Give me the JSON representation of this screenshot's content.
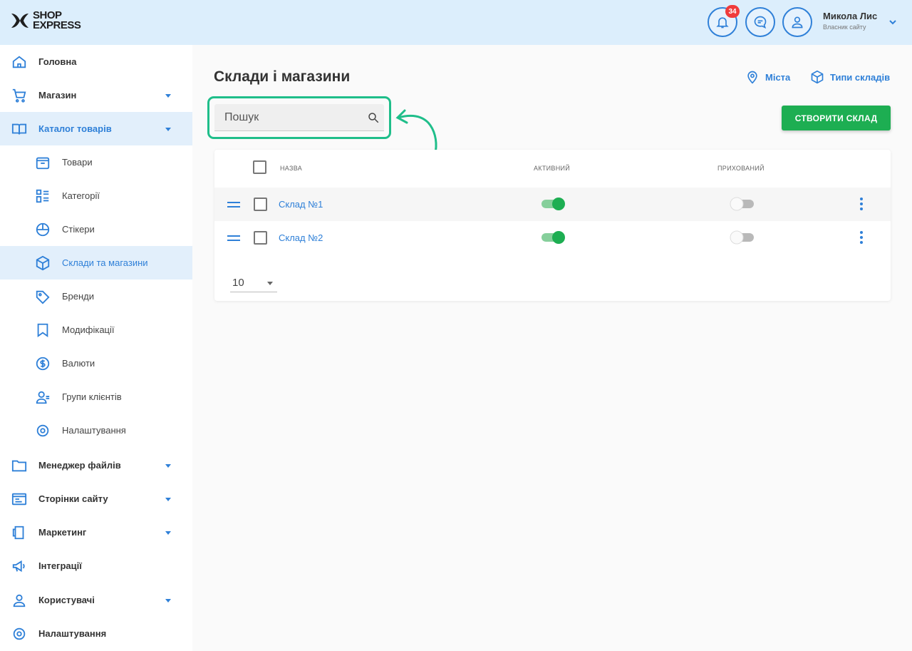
{
  "header": {
    "logo_line1": "SHOP",
    "logo_line2": "EXPRESS",
    "notifications_count": "34",
    "user_name": "Микола Лис",
    "user_role": "Власник сайту"
  },
  "sidebar": {
    "items": [
      {
        "label": "Головна",
        "icon": "home-icon",
        "has_caret": false
      },
      {
        "label": "Магазин",
        "icon": "cart-icon",
        "has_caret": true
      },
      {
        "label": "Каталог товарів",
        "icon": "book-icon",
        "has_caret": true,
        "active": true
      },
      {
        "label": "Менеджер файлів",
        "icon": "folder-icon",
        "has_caret": true
      },
      {
        "label": "Сторінки сайту",
        "icon": "pages-icon",
        "has_caret": true
      },
      {
        "label": "Маркетинг",
        "icon": "marketing-icon",
        "has_caret": true
      },
      {
        "label": "Інтеграції",
        "icon": "megaphone-icon",
        "has_caret": false
      },
      {
        "label": "Користувачі",
        "icon": "users-icon",
        "has_caret": true
      },
      {
        "label": "Налаштування",
        "icon": "gear-icon",
        "has_caret": false
      }
    ],
    "catalog_sub": [
      {
        "label": "Товари",
        "icon": "box-icon"
      },
      {
        "label": "Категорії",
        "icon": "categories-icon"
      },
      {
        "label": "Стікери",
        "icon": "sticker-icon"
      },
      {
        "label": "Склади та магазини",
        "icon": "warehouse-icon",
        "active": true
      },
      {
        "label": "Бренди",
        "icon": "tag-icon"
      },
      {
        "label": "Модифікації",
        "icon": "bookmark-icon"
      },
      {
        "label": "Валюти",
        "icon": "currency-icon"
      },
      {
        "label": "Групи клієнтів",
        "icon": "client-group-icon"
      },
      {
        "label": "Налаштування",
        "icon": "gear-icon"
      }
    ]
  },
  "main": {
    "title": "Склади і магазини",
    "links": {
      "cities": "Міста",
      "warehouse_types": "Типи складів"
    },
    "search": {
      "placeholder": "Пошук",
      "value": ""
    },
    "create_button": "СТВОРИТИ СКЛАД",
    "table": {
      "columns": {
        "name": "НАЗВА",
        "active": "АКТИВНИЙ",
        "hidden": "ПРИХОВАНИЙ"
      },
      "rows": [
        {
          "name": "Склад №1",
          "active": true,
          "hidden": false
        },
        {
          "name": "Склад №2",
          "active": true,
          "hidden": false
        }
      ]
    },
    "page_size": "10"
  },
  "colors": {
    "accent": "#2f80d8",
    "header_bg": "#dceefc",
    "active_bg": "#e2effb",
    "create_button": "#1dae52",
    "highlight": "#1fbe8a",
    "badge": "#f03b3b"
  }
}
